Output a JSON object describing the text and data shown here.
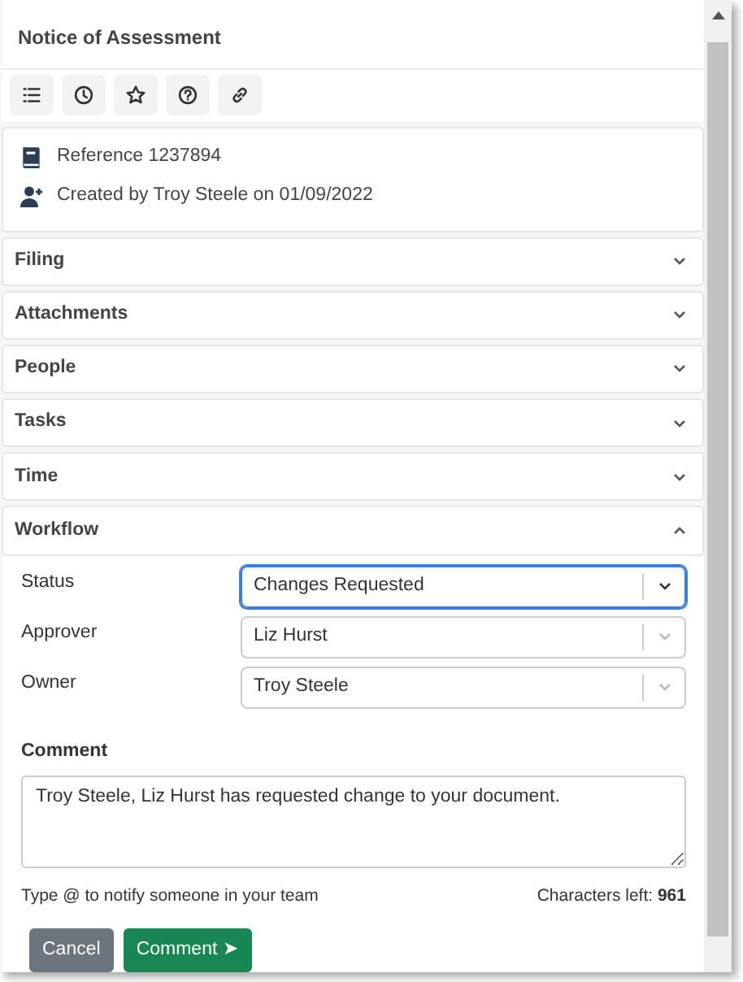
{
  "title": "Notice of Assessment",
  "toolbar": [
    {
      "kind": "checklist"
    },
    {
      "kind": "clock"
    },
    {
      "kind": "star"
    },
    {
      "kind": "help"
    },
    {
      "kind": "link"
    }
  ],
  "info": [
    {
      "kind": "book",
      "text": "Reference 1237894"
    },
    {
      "kind": "user-add",
      "text": "Created by Troy Steele on 01/09/2022"
    }
  ],
  "sections": [
    {
      "label": "Filing",
      "expanded": false
    },
    {
      "label": "Attachments",
      "expanded": false
    },
    {
      "label": "People",
      "expanded": false
    },
    {
      "label": "Tasks",
      "expanded": false
    },
    {
      "label": "Time",
      "expanded": false
    },
    {
      "label": "Workflow",
      "expanded": true
    }
  ],
  "workflow": {
    "fields": [
      {
        "label": "Status",
        "value": "Changes Requested",
        "focused": true
      },
      {
        "label": "Approver",
        "value": "Liz Hurst",
        "focused": false
      },
      {
        "label": "Owner",
        "value": "Troy Steele",
        "focused": false
      }
    ],
    "comment_label": "Comment",
    "comment": "Troy Steele, Liz Hurst has requested change to your document.",
    "hint": "Type @ to notify someone in your team",
    "characters_left": "Characters left: **961**",
    "buttons": [
      {
        "kind": "secondary",
        "label": "Cancel"
      },
      {
        "kind": "success",
        "label": "Comment ➤"
      }
    ]
  }
}
